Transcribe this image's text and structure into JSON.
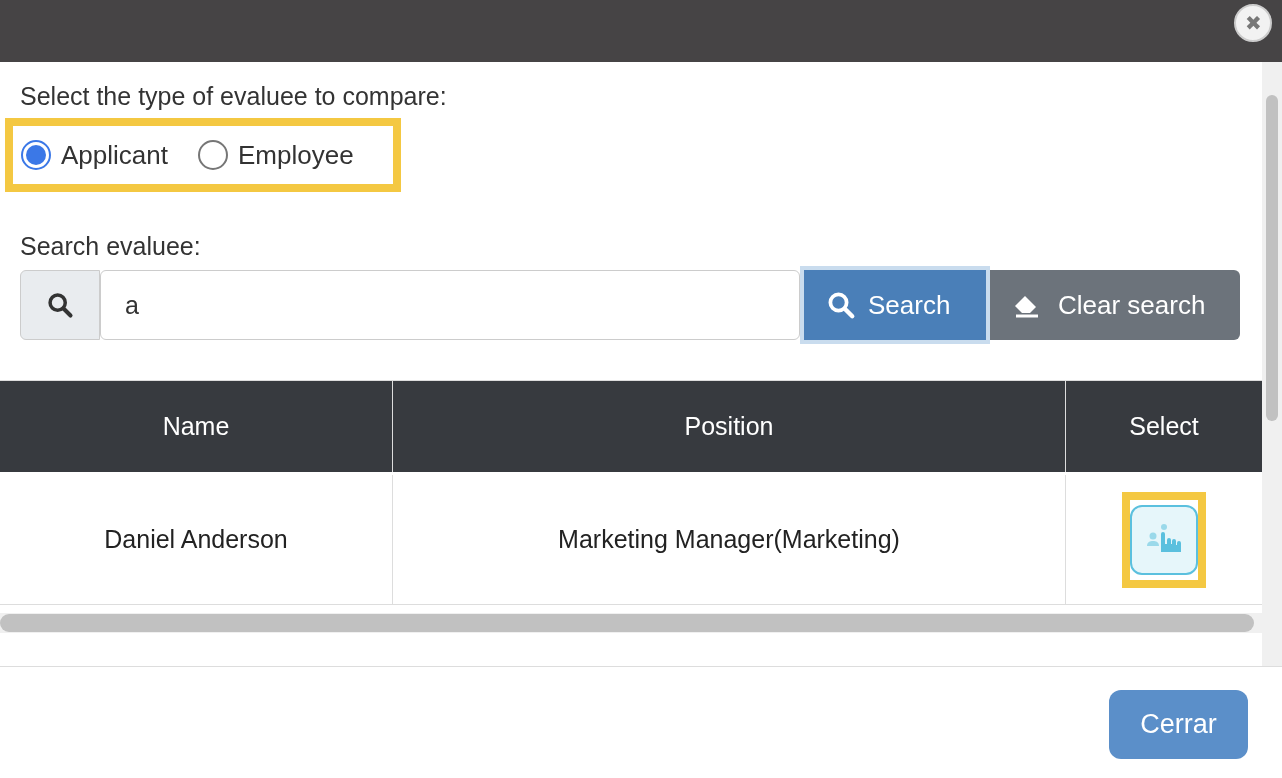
{
  "close_button": {
    "label": "✖"
  },
  "type_prompt": "Select the type of evaluee to compare:",
  "evaluee_types": [
    {
      "label": "Applicant",
      "selected": true
    },
    {
      "label": "Employee",
      "selected": false
    }
  ],
  "search": {
    "label": "Search evaluee:",
    "value": "a",
    "search_button": "Search",
    "clear_button": "Clear search"
  },
  "table": {
    "columns": [
      "Name",
      "Position",
      "Select"
    ],
    "rows": [
      {
        "name": "Daniel Anderson",
        "position": "Marketing Manager(Marketing)"
      }
    ]
  },
  "footer": {
    "close_button": "Cerrar"
  }
}
